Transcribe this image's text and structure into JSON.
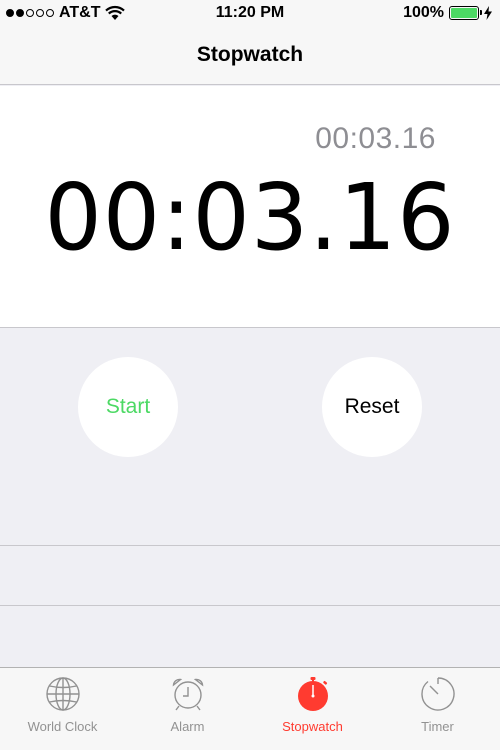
{
  "status_bar": {
    "carrier": "AT&T",
    "time": "11:20 PM",
    "battery_percent": "100%",
    "signal_bars_filled": 2,
    "signal_bars_total": 5,
    "battery_level": 1.0,
    "battery_color": "#4cd964"
  },
  "nav": {
    "title": "Stopwatch"
  },
  "display": {
    "lap_time": "00:03.16",
    "main_time": "00:03.16"
  },
  "controls": {
    "start_label": "Start",
    "reset_label": "Reset",
    "start_color": "#4cd964"
  },
  "tabs": [
    {
      "label": "World Clock",
      "icon": "globe-icon",
      "active": false
    },
    {
      "label": "Alarm",
      "icon": "alarm-clock-icon",
      "active": false
    },
    {
      "label": "Stopwatch",
      "icon": "stopwatch-icon",
      "active": true
    },
    {
      "label": "Timer",
      "icon": "timer-icon",
      "active": false
    }
  ],
  "colors": {
    "active_tab": "#ff3b30",
    "inactive_tab": "#929292"
  }
}
